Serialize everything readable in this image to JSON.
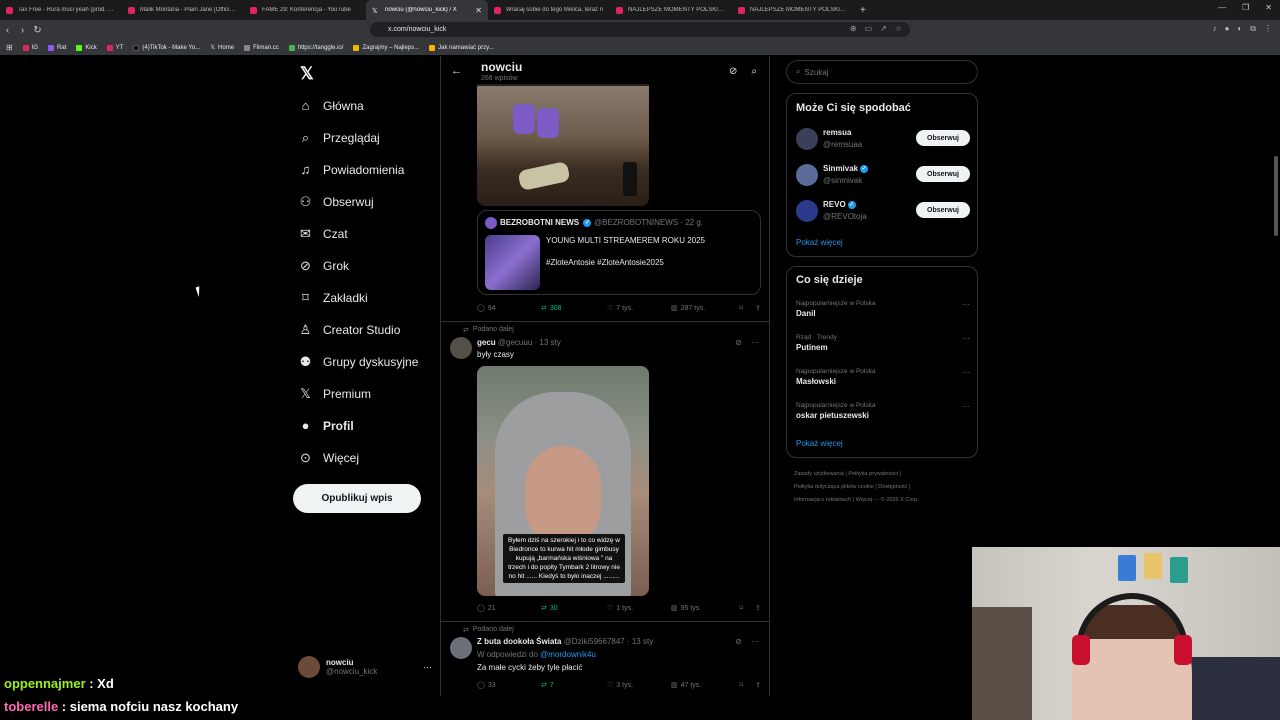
{
  "browser": {
    "tabs": [
      {
        "label": "Tax Free - Rura musi yeah (prod. CLIC",
        "icon": "youtube-icon"
      },
      {
        "label": "Malik Montana - Plain Jane [Official M",
        "icon": "youtube-icon"
      },
      {
        "label": "FAME 29: Konferencja - YouTube",
        "icon": "youtube-icon"
      },
      {
        "label": "nowciu (@nowciu_kick) / X",
        "icon": "x-icon",
        "active": true
      },
      {
        "label": "Wracaj sobie do tego Mielca, teraz n",
        "icon": "youtube-icon"
      },
      {
        "label": "NAJLEPSZE MOMENTY POLSKIEGO T",
        "icon": "youtube-icon"
      },
      {
        "label": "NAJLEPSZE MOMENTY POLSKIEGO T",
        "icon": "youtube-icon"
      }
    ],
    "url": "x.com/nowciu_kick",
    "bookmarks": [
      {
        "label": "IG"
      },
      {
        "label": "Rat"
      },
      {
        "label": "Kick"
      },
      {
        "label": "YT"
      },
      {
        "label": "(4)TikTok - Make Yo..."
      },
      {
        "label": "Home"
      },
      {
        "label": "Filman.cc"
      },
      {
        "label": "https://tanggle.io/"
      },
      {
        "label": "Zagrajmy – Najleps..."
      },
      {
        "label": "Jak namawiać przy..."
      }
    ]
  },
  "nav": {
    "items": [
      {
        "label": "Główna",
        "icon": "home-icon"
      },
      {
        "label": "Przeglądaj",
        "icon": "search-icon"
      },
      {
        "label": "Powiadomienia",
        "icon": "bell-icon"
      },
      {
        "label": "Obserwuj",
        "icon": "follow-icon"
      },
      {
        "label": "Czat",
        "icon": "mail-icon"
      },
      {
        "label": "Grok",
        "icon": "grok-icon"
      },
      {
        "label": "Zakładki",
        "icon": "bookmark-icon"
      },
      {
        "label": "Creator Studio",
        "icon": "creator-icon"
      },
      {
        "label": "Grupy dyskusyjne",
        "icon": "groups-icon"
      },
      {
        "label": "Premium",
        "icon": "x-icon"
      },
      {
        "label": "Profil",
        "icon": "profile-icon"
      },
      {
        "label": "Więcej",
        "icon": "more-icon"
      }
    ],
    "post_button": "Opublikuj wpis",
    "user": {
      "name": "nowciu",
      "handle": "@nowciu_kick"
    }
  },
  "feed": {
    "header": {
      "title": "nowciu",
      "subtitle": "266 wpisów"
    },
    "post1": {
      "quote": {
        "name": "BEZROBOTNI NEWS",
        "handle": "@BEZROBOTNINEWS · 22 g.",
        "text": "YOUNG MULTI STREAMEREM ROKU 2025",
        "tags": "#ZloteAntosie #ZloteAntosie2025"
      },
      "stats": {
        "replies": "94",
        "reposts": "308",
        "likes": "7 tys.",
        "views": "287 tys."
      }
    },
    "post2": {
      "repost_label": "Podano dalej",
      "name": "gecu",
      "handle": "@gecuuu · 13 sty",
      "text": "były czasy",
      "caption": "Byłem dziś na szerokiej i to co widzę w Biedronce to kurwa hit młode gimbusy kupują „barmańska wiśniowa \" na trzech i do popity Tymbark 2 litrowy nie no hit ...... Kiedyś to było inaczej .........",
      "stats": {
        "replies": "21",
        "reposts": "30",
        "likes": "1 tys.",
        "views": "95 tys."
      }
    },
    "post3": {
      "repost_label": "Podano dalej",
      "name": "Z buta dookoła Świata",
      "handle": "@Dziki59667847 · 13 sty",
      "reply_prefix": "W odpowiedzi do",
      "reply_to": "@mordownik4u",
      "text": "Za małe cycki żeby tyle płacić",
      "stats": {
        "replies": "33",
        "reposts": "7",
        "likes": "3 tys.",
        "views": "47 tys."
      }
    }
  },
  "sidebar": {
    "search_placeholder": "Szukaj",
    "who_title": "Może Ci się spodobać",
    "who": [
      {
        "name": "remsua",
        "handle": "@remsuaa",
        "verified": false
      },
      {
        "name": "Sinmivak",
        "handle": "@sinmivak",
        "verified": true
      },
      {
        "name": "REVO",
        "handle": "@REVOtoja",
        "verified": true
      }
    ],
    "follow_label": "Obserwuj",
    "show_more": "Pokaż więcej",
    "trends_title": "Co się dzieje",
    "trends": [
      {
        "context": "Najpopularniejsze w Polska",
        "name": "Danil"
      },
      {
        "context": "Rząd · Trendy",
        "name": "Putinem"
      },
      {
        "context": "Najpopularniejsze w Polska",
        "name": "Masłowski"
      },
      {
        "context": "Najpopularniejsze w Polska",
        "name": "oskar pietuszewski"
      }
    ],
    "footer": [
      "Zasady użytkowania",
      "Polityka prywatności",
      "Polityka dotycząca plików cookie",
      "Dostępność",
      "Informacja o reklamach",
      "Więcej ···",
      "© 2026 X Corp."
    ]
  },
  "chat": [
    {
      "user": "oppennajmer",
      "message": " : Xd"
    },
    {
      "user": "toberelle",
      "message": " : siema nofciu nasz kochany"
    }
  ],
  "colors": {
    "accent": "#1d9bf0",
    "repost_green": "#00ba7c",
    "background": "#000000"
  }
}
